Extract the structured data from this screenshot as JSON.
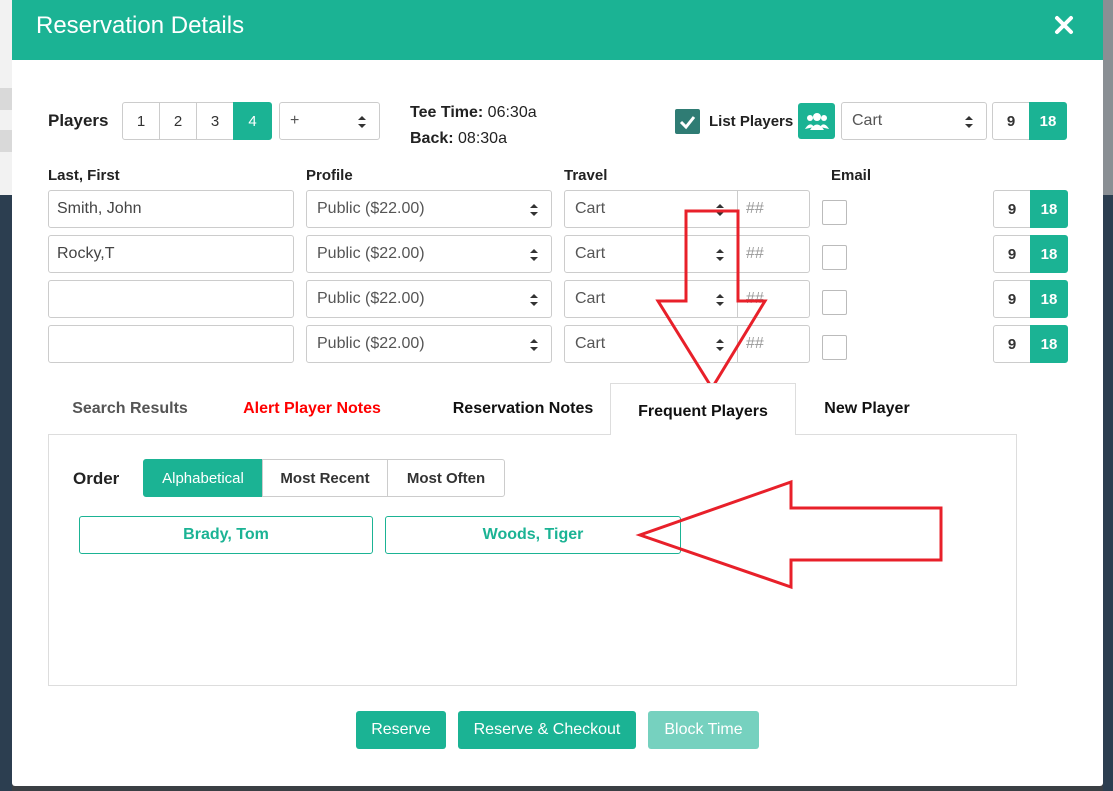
{
  "colors": {
    "accent": "#1bb394",
    "alert": "#ff0000",
    "annotation": "#e8202a"
  },
  "modal": {
    "title": "Reservation Details",
    "close_icon": "close-icon"
  },
  "players_row": {
    "label": "Players",
    "counts": [
      "1",
      "2",
      "3",
      "4"
    ],
    "selected_count": "4",
    "more_select": "+",
    "tee_time_label": "Tee Time:",
    "tee_time": "06:30a",
    "back_label": "Back:",
    "back_time": "08:30a",
    "list_players_label": "List Players",
    "list_players_checked": true,
    "group_icon": "users-icon",
    "travel_select": "Cart",
    "holes": [
      "9",
      "18"
    ],
    "selected_holes": "18"
  },
  "columns": {
    "name": "Last, First",
    "profile": "Profile",
    "travel": "Travel",
    "email": "Email"
  },
  "rows": [
    {
      "name": "Smith, John",
      "profile": "Public ($22.00)",
      "travel": "Cart",
      "cart_placeholder": "##",
      "holes": [
        "9",
        "18"
      ]
    },
    {
      "name": "Rocky,T",
      "profile": "Public ($22.00)",
      "travel": "Cart",
      "cart_placeholder": "##",
      "holes": [
        "9",
        "18"
      ]
    },
    {
      "name": "",
      "profile": "Public ($22.00)",
      "travel": "Cart",
      "cart_placeholder": "##",
      "holes": [
        "9",
        "18"
      ]
    },
    {
      "name": "",
      "profile": "Public ($22.00)",
      "travel": "Cart",
      "cart_placeholder": "##",
      "holes": [
        "9",
        "18"
      ]
    }
  ],
  "tabs": [
    {
      "label": "Search Results"
    },
    {
      "label": "Alert Player Notes"
    },
    {
      "label": "Reservation Notes"
    },
    {
      "label": "Frequent Players",
      "active": true
    },
    {
      "label": "New Player"
    }
  ],
  "frequent": {
    "order_label": "Order",
    "order_options": [
      "Alphabetical",
      "Most Recent",
      "Most Often"
    ],
    "selected_order": "Alphabetical",
    "players": [
      "Brady, Tom",
      "Woods, Tiger"
    ]
  },
  "actions": {
    "reserve": "Reserve",
    "reserve_checkout": "Reserve & Checkout",
    "block_time": "Block Time"
  }
}
